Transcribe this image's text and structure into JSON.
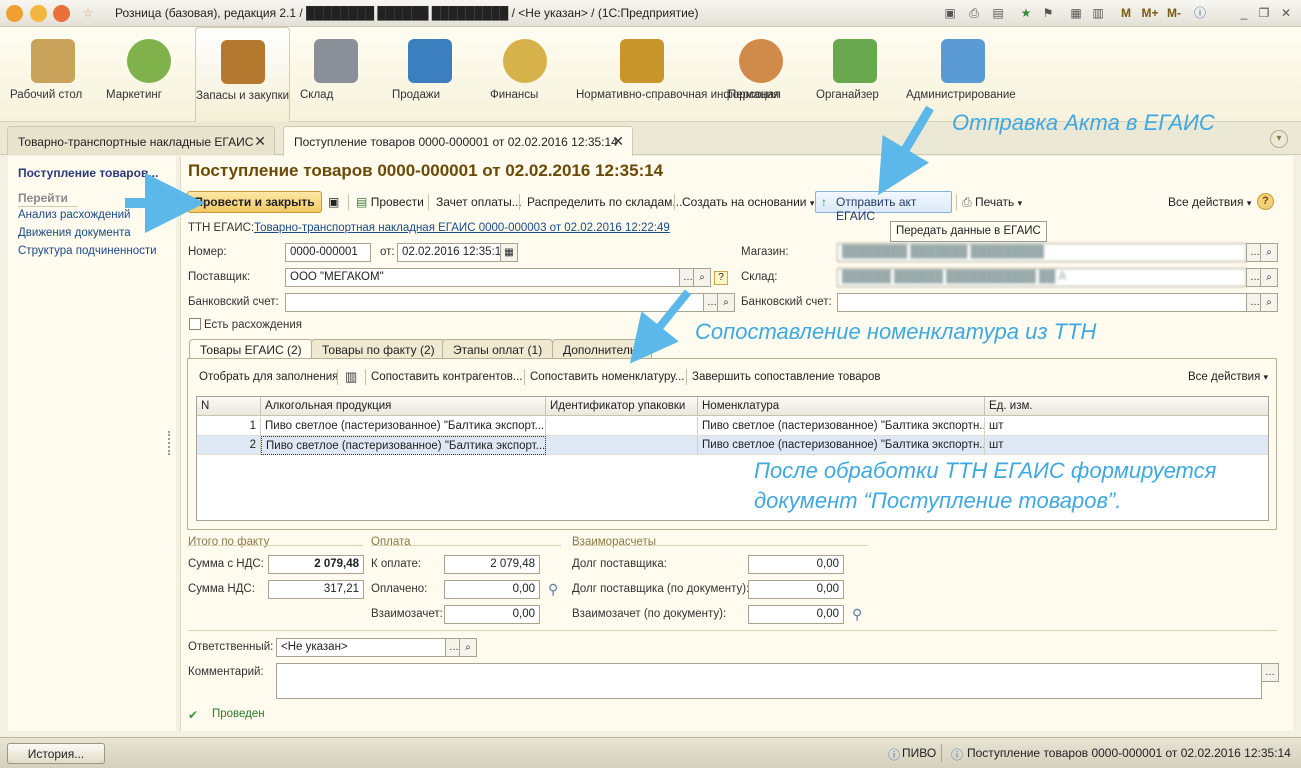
{
  "window": {
    "title": "Розница (базовая), редакция 2.1 / ████████ ██████ █████████ / <Не указан> / (1С:Предприятие)",
    "right_buttons": [
      "M",
      "M+",
      "M-"
    ]
  },
  "sections": [
    {
      "label": "Рабочий стол",
      "icon": "desktop-icon",
      "color": "#c9a35a"
    },
    {
      "label": "Маркетинг",
      "icon": "pie-chart-icon",
      "color": "#7fb24a"
    },
    {
      "label": "Запасы и закупки",
      "icon": "boxes-icon",
      "color": "#b4782e"
    },
    {
      "label": "Склад",
      "icon": "warehouse-icon",
      "color": "#8a8f98"
    },
    {
      "label": "Продажи",
      "icon": "cash-register-icon",
      "color": "#3b7fbf"
    },
    {
      "label": "Финансы",
      "icon": "coins-icon",
      "color": "#d7b24a"
    },
    {
      "label": "Нормативно-справочная информация",
      "icon": "binders-icon",
      "color": "#c9962b"
    },
    {
      "label": "Персонал",
      "icon": "person-icon",
      "color": "#d08a4a"
    },
    {
      "label": "Органайзер",
      "icon": "clipboard-icon",
      "color": "#6aa84f"
    },
    {
      "label": "Администрирование",
      "icon": "admin-icon",
      "color": "#5b9bd5"
    }
  ],
  "open_tabs": [
    {
      "label": "Товарно-транспортные накладные ЕГАИС"
    },
    {
      "label": "Поступление товаров 0000-000001 от 02.02.2016 12:35:14"
    }
  ],
  "left_nav": {
    "current": "Поступление товаров...",
    "goto": "Перейти",
    "items": [
      "Анализ расхождений",
      "Движения документа",
      "Структура подчиненности"
    ]
  },
  "doc": {
    "title": "Поступление товаров 0000-000001 от 02.02.2016 12:35:14",
    "toolbar": {
      "post_close": "Провести и закрыть",
      "post": "Провести",
      "offset": "Зачет оплаты...",
      "distribute": "Распределить по складам...",
      "create_based": "Создать на основании",
      "send_egais": "Отправить акт ЕГАИС",
      "print": "Печать",
      "all_actions": "Все действия",
      "help": "?"
    },
    "tooltip": "Передать данные в ЕГАИС",
    "ttn_label": "ТТН ЕГАИС:",
    "ttn_link": "Товарно-транспортная накладная ЕГАИС 0000-000003 от 02.02.2016 12:22:49",
    "number_label": "Номер:",
    "number": "0000-000001",
    "from_label": "от:",
    "date": "02.02.2016 12:35:14",
    "supplier_label": "Поставщик:",
    "supplier": "ООО \"МЕГАКОМ\"",
    "bank_label": "Банковский счет:",
    "bank": "",
    "store_label": "Магазин:",
    "store": "████████ ███████ █████████",
    "warehouse_label": "Склад:",
    "warehouse": "██████ ██████ ███████████ ██ А",
    "bank2_label": "Банковский счет:",
    "bank2": "",
    "discrepancies": "Есть расхождения",
    "discrepancies_checked": false
  },
  "inner_tabs": [
    {
      "label": "Товары ЕГАИС (2)"
    },
    {
      "label": "Товары по факту (2)"
    },
    {
      "label": "Этапы оплат (1)"
    },
    {
      "label": "Дополнительно"
    }
  ],
  "grid_toolbar": {
    "select": "Отобрать для заполнения",
    "match_partners": "Сопоставить контрагентов...",
    "match_items": "Сопоставить номенклатуру...",
    "finish_match": "Завершить сопоставление товаров",
    "all_actions": "Все действия"
  },
  "grid": {
    "columns": [
      "N",
      "Алкогольная продукция",
      "Идентификатор упаковки",
      "Номенклатура",
      "Ед. изм."
    ],
    "rows": [
      [
        "1",
        "Пиво светлое (пастеризованное) \"Балтика экспорт...",
        "",
        "Пиво светлое (пастеризованное) \"Балтика экспортн...",
        "шт"
      ],
      [
        "2",
        "Пиво светлое (пастеризованное) \"Балтика экспорт...",
        "",
        "Пиво светлое (пастеризованное) \"Балтика экспортн...",
        "шт"
      ]
    ]
  },
  "totals": {
    "fact_group": "Итого по факту",
    "sum_vat_label": "Сумма с НДС:",
    "sum_vat": "2 079,48",
    "vat_label": "Сумма НДС:",
    "vat": "317,21",
    "pay_group": "Оплата",
    "to_pay_label": "К оплате:",
    "to_pay": "2 079,48",
    "paid_label": "Оплачено:",
    "paid": "0,00",
    "offset_label": "Взаимозачет:",
    "offset": "0,00",
    "mutual_group": "Взаиморасчеты",
    "debt_label": "Долг поставщика:",
    "debt": "0,00",
    "debt_doc_label": "Долг поставщика (по документу):",
    "debt_doc": "0,00",
    "offset_doc_label": "Взаимозачет (по документу):",
    "offset_doc": "0,00"
  },
  "footer": {
    "responsible_label": "Ответственный:",
    "responsible": "<Не указан>",
    "comment_label": "Комментарий:",
    "comment": "",
    "status": "Проведен"
  },
  "callouts": {
    "send_act": "Отправка Акта в ЕГАИС",
    "match_nomenclature": "Сопоставление номенклатура из ТТН",
    "after_line1": "После обработки ТТН ЕГАИС формируется",
    "after_line2": "документ “Поступление товаров”."
  },
  "statusbar": {
    "history": "История...",
    "item1": "ПИВО",
    "item2": "Поступление товаров 0000-000001 от 02.02.2016 12:35:14"
  },
  "colors": {
    "accent": "#3fa8e0",
    "title": "#6b4a06",
    "link": "#1a4a8a"
  }
}
